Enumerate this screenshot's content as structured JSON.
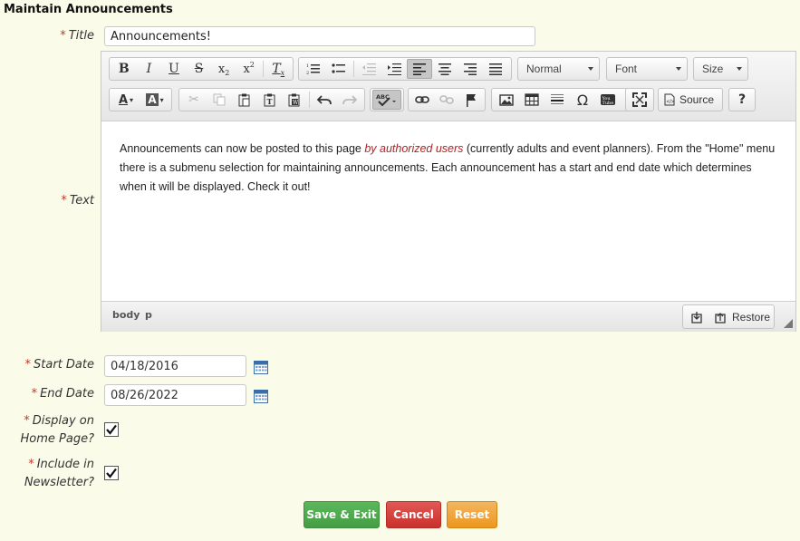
{
  "page": {
    "heading": "Maintain Announcements"
  },
  "fields": {
    "title": {
      "label": "Title",
      "value": "Announcements!"
    },
    "text": {
      "label": "Text"
    },
    "start_date": {
      "label": "Start Date",
      "value": "04/18/2016"
    },
    "end_date": {
      "label": "End Date",
      "value": "08/26/2022"
    },
    "display_home": {
      "label_line1": "Display on",
      "label_line2": "Home Page?",
      "checked": true
    },
    "include_newsletter": {
      "label_line1": "Include in",
      "label_line2": "Newsletter?",
      "checked": true
    },
    "required_marker": "*"
  },
  "editor": {
    "format_combo": "Normal",
    "font_combo": "Font",
    "size_combo": "Size",
    "source_label": "Source",
    "help_label": "?",
    "content": {
      "part1": "Announcements can now be posted to this page ",
      "emphasis": "by authorized users",
      "part2": " (currently adults and event planners). From the \"Home\" menu there is a submenu selection for maintaining announcements. Each announcement has a start and end date which determines when it will be displayed. Check it out!"
    },
    "status_path": [
      "body",
      "p"
    ],
    "restore_label": "Restore"
  },
  "buttons": {
    "save_exit": "Save & Exit",
    "cancel": "Cancel",
    "reset": "Reset"
  },
  "colors": {
    "background": "#fbfbe9",
    "required": "#c0392b",
    "save": "#4caf50",
    "cancel": "#d9534f",
    "reset": "#f0ad4e"
  }
}
